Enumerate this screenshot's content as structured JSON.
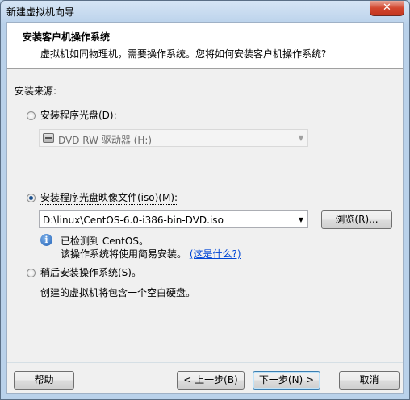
{
  "window": {
    "title": "新建虚拟机向导",
    "close_label": "✕"
  },
  "header": {
    "title": "安装客户机操作系统",
    "subtitle": "虚拟机如同物理机，需要操作系统。您将如何安装客户机操作系统?"
  },
  "install_source": {
    "label": "安装来源:",
    "disc_option": {
      "label": "安装程序光盘(D):",
      "selected": false
    },
    "disc_drive": {
      "value": "DVD RW 驱动器 (H:)",
      "icon": "optical-drive-icon"
    },
    "iso_option": {
      "label": "安装程序光盘映像文件(iso)(M):",
      "selected": true
    },
    "iso_path": {
      "value": "D:\\linux\\CentOS-6.0-i386-bin-DVD.iso"
    },
    "browse_label": "浏览(R)...",
    "detect_line1": "已检测到 CentOS。",
    "detect_line2": "该操作系统将使用简易安装。",
    "detect_link": "(这是什么?)",
    "later_option": {
      "label": "稍后安装操作系统(S)。",
      "selected": false
    },
    "later_note": "创建的虚拟机将包含一个空白硬盘。"
  },
  "footer": {
    "help_label": "帮助",
    "back_label": "< 上一步(B)",
    "next_label": "下一步(N) >",
    "cancel_label": "取消"
  }
}
